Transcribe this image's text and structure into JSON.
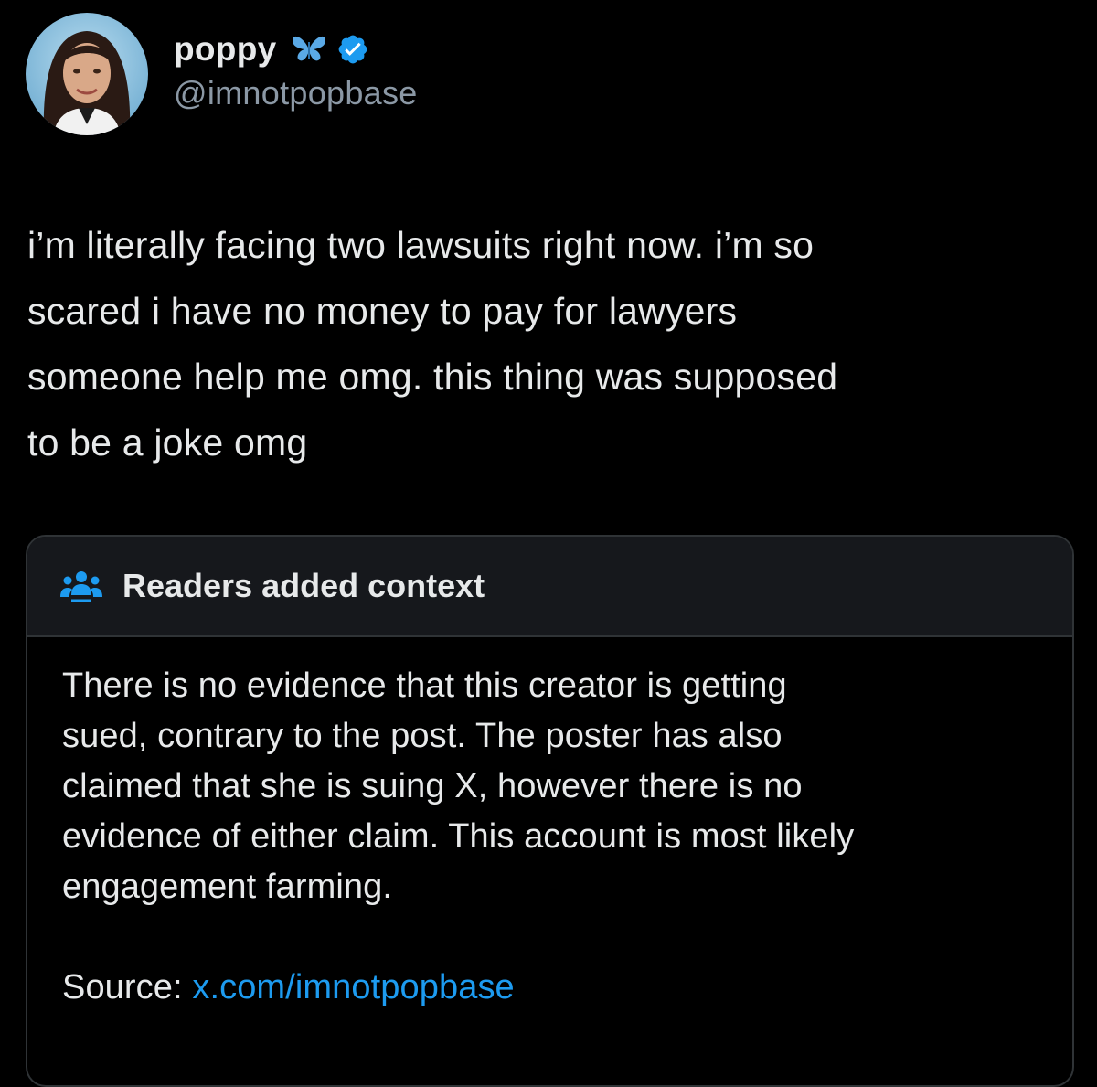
{
  "author": {
    "display_name": "poppy",
    "handle": "@imnotpopbase",
    "name_emoji": "butterfly-icon",
    "verified": true
  },
  "tweet": {
    "text": "i’m literally facing two lawsuits right now. i’m so\nscared i have no money to pay for lawyers\nsomeone help me omg. this thing was supposed\nto be a joke omg"
  },
  "community_note": {
    "title": "Readers added context",
    "body": "There is no evidence that this creator is getting\nsued, contrary to the post. The poster has also\nclaimed that she is suing X, however there is no\nevidence of either claim. This account is most likely\nengagement farming.",
    "source_label": "Source:",
    "source_link": "x.com/imnotpopbase"
  },
  "colors": {
    "background": "#000000",
    "text_primary": "#e7e9ea",
    "text_secondary": "#8b98a5",
    "accent": "#1d9bf0",
    "note_header_bg": "#16181c",
    "border": "#2f3336"
  }
}
